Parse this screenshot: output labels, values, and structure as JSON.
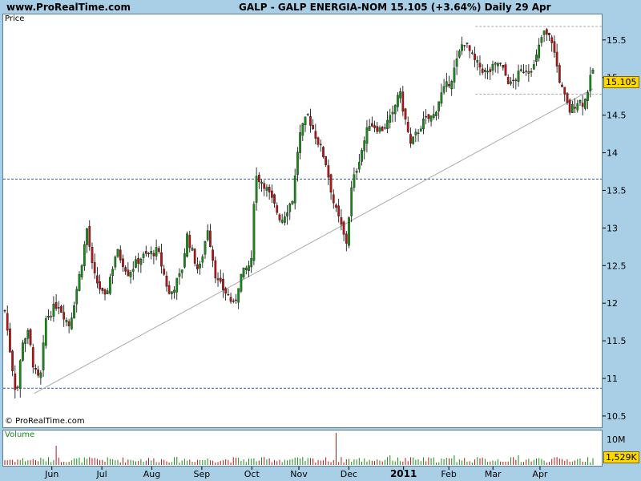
{
  "header": {
    "site": "www.ProRealTime.com",
    "title": "GALP - GALP ENERGIA-NOM    15.105 (+3.64%)    Daily  29 Apr"
  },
  "panels": {
    "price_label": "Price",
    "volume_label": "Volume",
    "copyright": "© ProRealTime.com"
  },
  "colors": {
    "background": "#a9cfe6",
    "up_candle": "#1a8a1a",
    "down_candle": "#b01818",
    "grid_dash": "#3355aa",
    "value_tag": "#ffd800"
  },
  "chart_data": {
    "type": "candlestick",
    "title": "GALP - GALP ENERGIA-NOM",
    "last_price": "15.105",
    "last_change": "+3.64%",
    "period": "Daily",
    "date": "29 Apr",
    "y_ticks": [
      "10.5",
      "11",
      "11.5",
      "12",
      "12.5",
      "13",
      "13.5",
      "14",
      "14.5",
      "15",
      "15.5"
    ],
    "ylim": [
      10.35,
      15.85
    ],
    "price_tag": "15.105",
    "x_labels": [
      {
        "label": "Jun",
        "t": 0.08
      },
      {
        "label": "Jul",
        "t": 0.165
      },
      {
        "label": "Aug",
        "t": 0.25
      },
      {
        "label": "Sep",
        "t": 0.335
      },
      {
        "label": "Oct",
        "t": 0.42
      },
      {
        "label": "Nov",
        "t": 0.5
      },
      {
        "label": "Dec",
        "t": 0.585
      },
      {
        "label": "2011",
        "t": 0.678
      },
      {
        "label": "Feb",
        "t": 0.755
      },
      {
        "label": "Mar",
        "t": 0.83
      },
      {
        "label": "Apr",
        "t": 0.91
      }
    ],
    "horizontal_lines": [
      {
        "value": 13.65,
        "style": "dashed-blue"
      },
      {
        "value": 10.87,
        "style": "dashed-blue"
      },
      {
        "value": 15.68,
        "style": "dashed-gray",
        "from_t": 0.8
      },
      {
        "value": 14.78,
        "style": "dashed-gray",
        "from_t": 0.8
      }
    ],
    "trendline": {
      "from": {
        "t": 0.05,
        "v": 10.8
      },
      "to": {
        "t": 1.0,
        "v": 14.85
      }
    },
    "close_keypoints": [
      [
        0.0,
        11.9
      ],
      [
        0.01,
        11.3
      ],
      [
        0.02,
        10.75
      ],
      [
        0.03,
        11.5
      ],
      [
        0.04,
        11.6
      ],
      [
        0.05,
        11.1
      ],
      [
        0.06,
        10.95
      ],
      [
        0.07,
        11.8
      ],
      [
        0.09,
        12.0
      ],
      [
        0.11,
        11.7
      ],
      [
        0.13,
        12.5
      ],
      [
        0.14,
        13.0
      ],
      [
        0.15,
        12.4
      ],
      [
        0.17,
        12.05
      ],
      [
        0.19,
        12.7
      ],
      [
        0.21,
        12.4
      ],
      [
        0.23,
        12.6
      ],
      [
        0.26,
        12.7
      ],
      [
        0.28,
        12.1
      ],
      [
        0.3,
        12.4
      ],
      [
        0.31,
        12.9
      ],
      [
        0.33,
        12.4
      ],
      [
        0.345,
        13.0
      ],
      [
        0.36,
        12.3
      ],
      [
        0.38,
        12.1
      ],
      [
        0.39,
        11.95
      ],
      [
        0.4,
        12.35
      ],
      [
        0.42,
        12.55
      ],
      [
        0.425,
        13.7
      ],
      [
        0.44,
        13.6
      ],
      [
        0.455,
        13.35
      ],
      [
        0.47,
        13.1
      ],
      [
        0.49,
        13.4
      ],
      [
        0.5,
        14.2
      ],
      [
        0.515,
        14.5
      ],
      [
        0.53,
        14.2
      ],
      [
        0.545,
        13.9
      ],
      [
        0.56,
        13.3
      ],
      [
        0.575,
        12.95
      ],
      [
        0.58,
        12.75
      ],
      [
        0.59,
        13.55
      ],
      [
        0.6,
        13.85
      ],
      [
        0.62,
        14.4
      ],
      [
        0.64,
        14.3
      ],
      [
        0.66,
        14.5
      ],
      [
        0.67,
        14.85
      ],
      [
        0.69,
        14.1
      ],
      [
        0.71,
        14.4
      ],
      [
        0.73,
        14.5
      ],
      [
        0.74,
        14.75
      ],
      [
        0.76,
        15.0
      ],
      [
        0.78,
        15.5
      ],
      [
        0.8,
        15.2
      ],
      [
        0.82,
        15.05
      ],
      [
        0.84,
        15.2
      ],
      [
        0.86,
        14.9
      ],
      [
        0.88,
        15.1
      ],
      [
        0.9,
        15.15
      ],
      [
        0.915,
        15.6
      ],
      [
        0.93,
        15.5
      ],
      [
        0.945,
        14.9
      ],
      [
        0.96,
        14.55
      ],
      [
        0.975,
        14.7
      ],
      [
        0.985,
        14.65
      ],
      [
        1.0,
        15.105
      ]
    ],
    "volume_ticks": [
      "10M"
    ],
    "volume_tag": "1,529K"
  }
}
